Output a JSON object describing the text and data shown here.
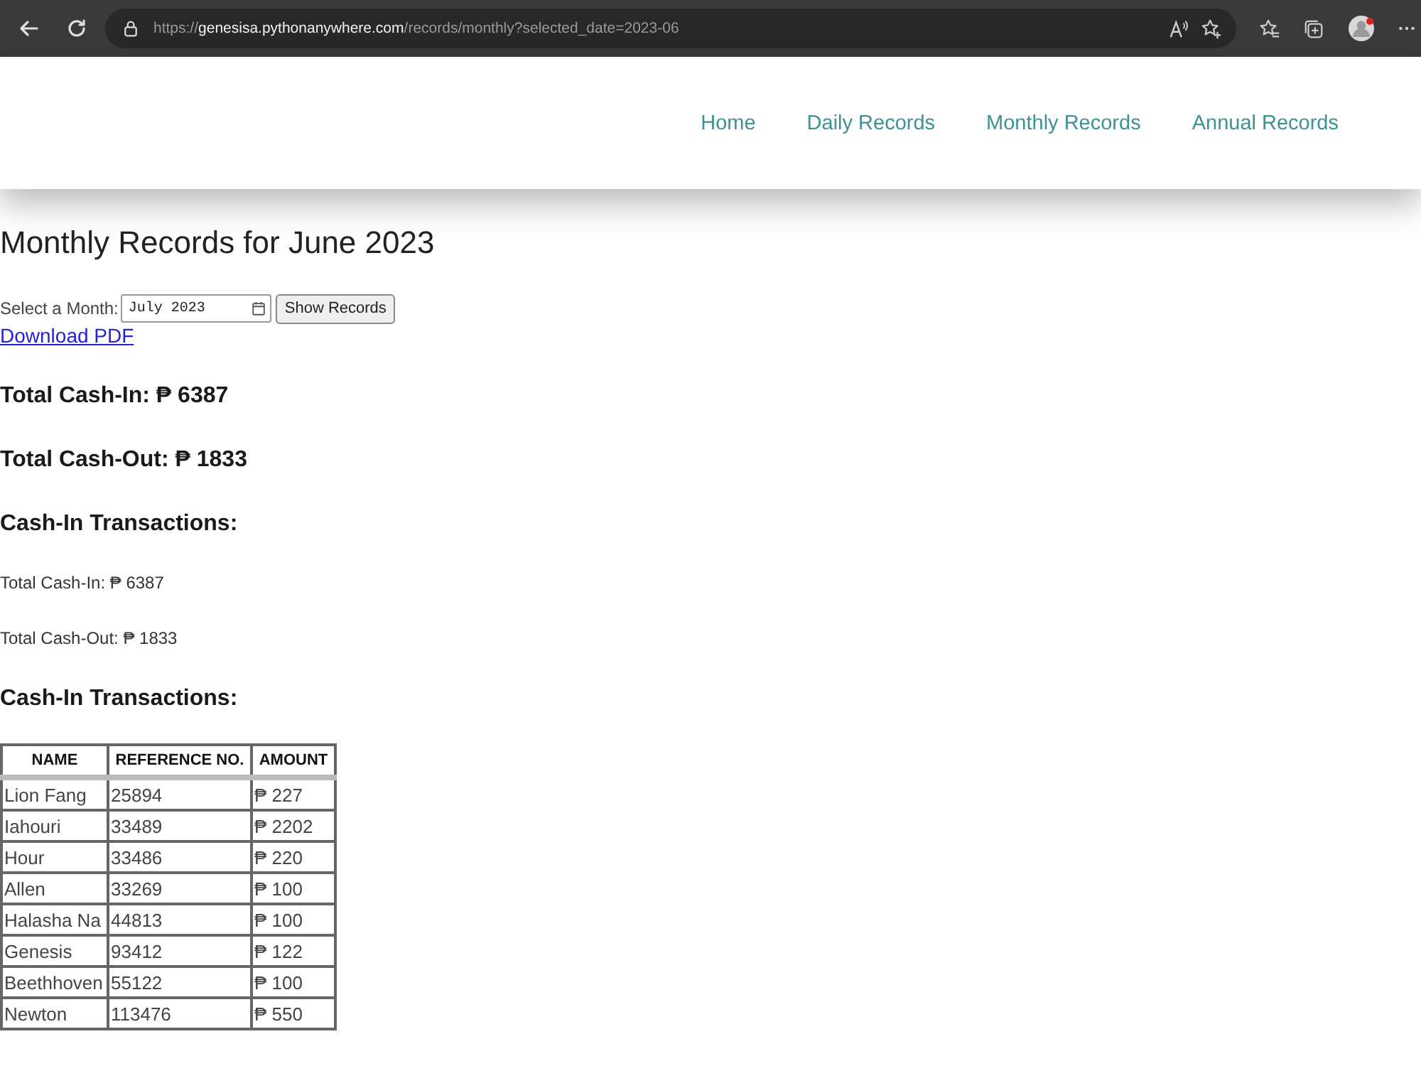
{
  "browser": {
    "url": {
      "scheme": "https://",
      "host": "genesisa.pythonanywhere.com",
      "path": "/records/monthly?selected_date=2023-06"
    }
  },
  "nav": {
    "links": [
      {
        "label": "Home"
      },
      {
        "label": "Daily Records"
      },
      {
        "label": "Monthly Records"
      },
      {
        "label": "Annual Records"
      }
    ]
  },
  "page": {
    "title": "Monthly Records for June 2023",
    "month_picker": {
      "label": "Select a Month:",
      "value": "July 2023"
    },
    "show_button": "Show Records",
    "download_link": "Download PDF",
    "blocks": [
      {
        "kind": "total",
        "text": "Total Cash-In: ₱ 6387"
      },
      {
        "kind": "total",
        "text": "Total Cash-Out: ₱ 1833"
      },
      {
        "kind": "heading",
        "text": "Cash-In Transactions:"
      },
      {
        "kind": "note",
        "text": "Total Cash-In: ₱ 6387"
      },
      {
        "kind": "note",
        "text": "Total Cash-Out: ₱ 1833"
      },
      {
        "kind": "heading",
        "text": "Cash-In Transactions:"
      }
    ]
  },
  "table": {
    "columns": [
      "NAME",
      "REFERENCE NO.",
      "AMOUNT"
    ],
    "rows": [
      [
        "Lion Fang",
        "25894",
        "₱ 227"
      ],
      [
        "Iahouri",
        "33489",
        "₱ 2202"
      ],
      [
        "Hour",
        "33486",
        "₱ 220"
      ],
      [
        "Allen",
        "33269",
        "₱ 100"
      ],
      [
        "Halasha Na",
        "44813",
        "₱ 100"
      ],
      [
        "Genesis",
        "93412",
        "₱ 122"
      ],
      [
        "Beethhoven",
        "55122",
        "₱ 100"
      ],
      [
        "Newton",
        "113476",
        "₱ 550"
      ]
    ]
  }
}
